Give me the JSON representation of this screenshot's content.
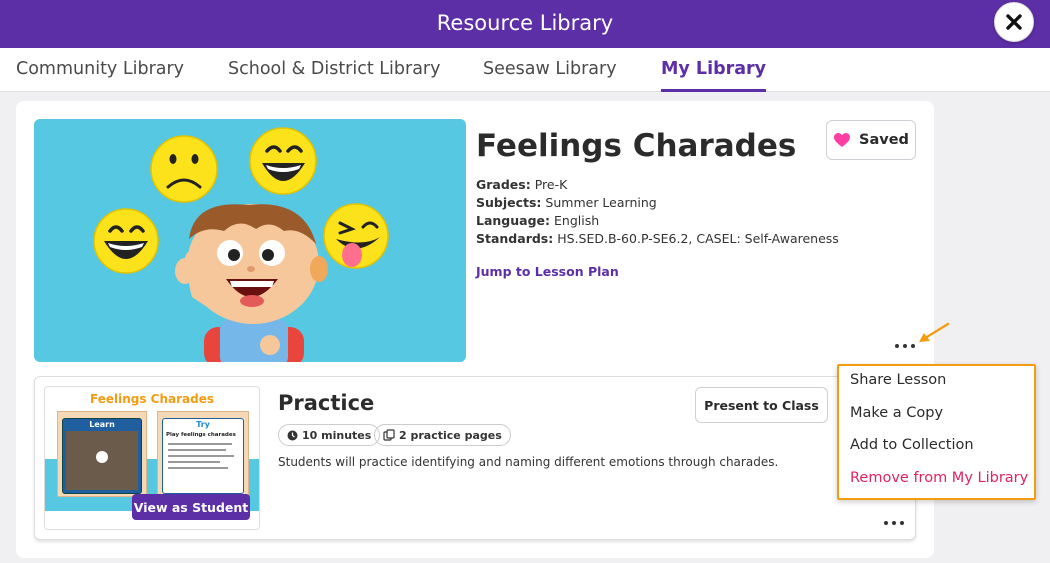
{
  "header": {
    "title": "Resource Library"
  },
  "tabs": [
    {
      "label": "Community Library"
    },
    {
      "label": "School & District Library"
    },
    {
      "label": "Seesaw Library"
    },
    {
      "label": "My Library"
    }
  ],
  "lesson": {
    "title": "Feelings Charades",
    "saved_label": "Saved",
    "meta": [
      {
        "label": "Grades:",
        "value": "Pre-K"
      },
      {
        "label": "Subjects:",
        "value": "Summer Learning"
      },
      {
        "label": "Language:",
        "value": "English"
      },
      {
        "label": "Standards:",
        "value": "HS.SED.B-60.P-SE6.2, CASEL: Self-Awareness"
      }
    ],
    "jump_link": "Jump to Lesson Plan"
  },
  "activity": {
    "thumb_title": "Feelings Charades",
    "thumb_learn": "Learn",
    "thumb_try": "Try",
    "thumb_try_heading": "Play feelings charades",
    "view_student": "View as Student",
    "title": "Practice",
    "duration": "10 minutes",
    "pages": "2 practice pages",
    "description": "Students will practice identifying and naming different emotions through charades.",
    "present_label": "Present to Class"
  },
  "menu": {
    "items": [
      "Share Lesson",
      "Make a Copy",
      "Add to Collection",
      "Remove from My Library"
    ]
  },
  "colors": {
    "brand": "#5d2fa6",
    "highlight": "#f39c12",
    "danger": "#e0245e",
    "heart": "#ff3ea5"
  }
}
